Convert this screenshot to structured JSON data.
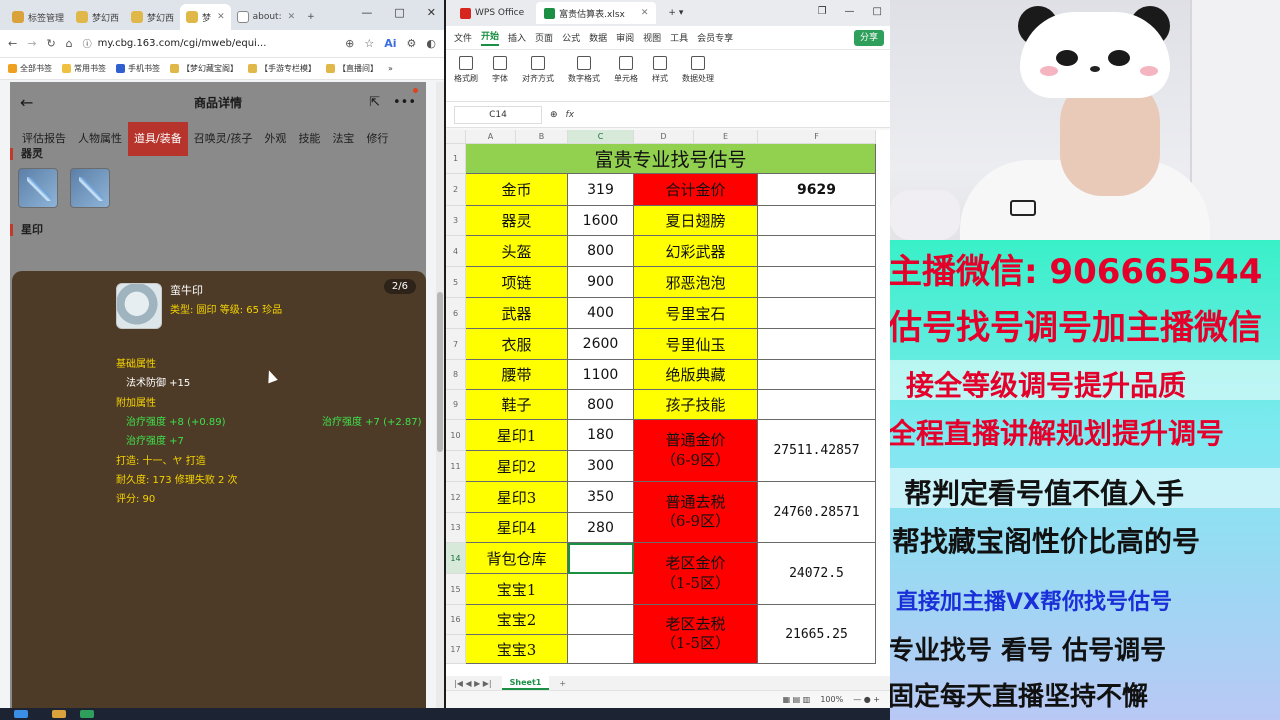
{
  "browser": {
    "tabs": [
      {
        "label": "标签管理",
        "color": "#d9a23a"
      },
      {
        "label": "梦幻西",
        "color": "#e0b84a"
      },
      {
        "label": "梦幻西",
        "color": "#e0b84a"
      },
      {
        "label": "梦",
        "color": "#e0b84a"
      },
      {
        "label": "about:",
        "color": "#888888"
      }
    ],
    "new_tab": "+",
    "window_controls": [
      "—",
      "□",
      "✕"
    ],
    "url": "my.cbg.163.com/cgi/mweb/equi...",
    "ai_label": "Ai",
    "bookmarks": [
      "全部书签",
      "常用书签",
      "手机书签",
      "【梦幻藏宝阁】",
      "【手游专栏模】",
      "【直播间】"
    ],
    "bookmarks_more": "»"
  },
  "mobile": {
    "title": "商品详情",
    "tabs": [
      "评估报告",
      "人物属性",
      "道具/装备",
      "召唤灵/孩子",
      "外观",
      "技能",
      "法宝",
      "修行"
    ],
    "active_tab": 2,
    "section_qiling": "器灵",
    "section_xingyin": "星印"
  },
  "popup": {
    "pager": "2/6",
    "item_name": "蛮牛印",
    "item_meta": "类型: 圆印  等级: 65  珍品",
    "base_title": "基础属性",
    "base_attr": "法术防御 +15",
    "extra_title": "附加属性",
    "extra_1": "治疗强度 +8 (+0.89)",
    "extra_1b": "治疗强度 +7 (+2.87)",
    "extra_2": "治疗强度 +7",
    "forge": "打造: 十一、ヤ 打造",
    "durability": "耐久度: 173 修理失败 2 次",
    "score": "评分: 90"
  },
  "wps": {
    "app_tab": "WPS Office",
    "file_tab": "富贵估算表.xlsx",
    "ribbon_tabs": [
      "文件",
      "开始",
      "插入",
      "页面",
      "公式",
      "数据",
      "审阅",
      "视图",
      "工具",
      "会员专享"
    ],
    "ribbon_active": 1,
    "share": "分享",
    "ribbon_groups": [
      "格式刷",
      "字体",
      "对齐方式",
      "数字格式",
      "单元格",
      "样式",
      "数据处理"
    ],
    "cell_ref": "C14",
    "fx": "fx",
    "columns": [
      "A",
      "B",
      "C",
      "D",
      "E",
      "F"
    ],
    "rows": [
      "1",
      "2",
      "3",
      "4",
      "5",
      "6",
      "7",
      "8",
      "9",
      "10",
      "11",
      "12",
      "13",
      "14",
      "15",
      "16",
      "17"
    ],
    "title": "富贵专业找号估号",
    "items_left": [
      {
        "name": "金币",
        "value": "319"
      },
      {
        "name": "器灵",
        "value": "1600"
      },
      {
        "name": "头盔",
        "value": "800"
      },
      {
        "name": "项链",
        "value": "900"
      },
      {
        "name": "武器",
        "value": "400"
      },
      {
        "name": "衣服",
        "value": "2600"
      },
      {
        "name": "腰带",
        "value": "1100"
      },
      {
        "name": "鞋子",
        "value": "800"
      },
      {
        "name": "星印1",
        "value": "180"
      },
      {
        "name": "星印2",
        "value": "300"
      },
      {
        "name": "星印3",
        "value": "350"
      },
      {
        "name": "星印4",
        "value": "280"
      },
      {
        "name": "背包仓库",
        "value": ""
      },
      {
        "name": "宝宝1",
        "value": ""
      },
      {
        "name": "宝宝2",
        "value": ""
      },
      {
        "name": "宝宝3",
        "value": ""
      }
    ],
    "total_label": "合计金价",
    "total_value": "9629",
    "extras": [
      "夏日翅膀",
      "幻彩武器",
      "邪恶泡泡",
      "号里宝石",
      "号里仙玉",
      "绝版典藏",
      "孩子技能"
    ],
    "prices": [
      {
        "label1": "普通金价",
        "label2": "（6-9区）",
        "value": "27511.42857"
      },
      {
        "label1": "普通去税",
        "label2": "（6-9区）",
        "value": "24760.28571"
      },
      {
        "label1": "老区金价",
        "label2": "（1-5区）",
        "value": "24072.5"
      },
      {
        "label1": "老区去税",
        "label2": "（1-5区）",
        "value": "21665.25"
      }
    ],
    "sheet_tab": "Sheet1",
    "zoom": "100%"
  },
  "stream": {
    "lines": [
      "主播微信: 906665544",
      "估号找号调号加主播微信",
      "接全等级调号提升品质",
      "全程直播讲解规划提升调号",
      "帮判定看号值不值入手",
      "帮找藏宝阁性价比高的号",
      "直接加主播VX帮你找号估号",
      "专业找号  看号  估号调号",
      "固定每天直播坚持不懈"
    ]
  }
}
